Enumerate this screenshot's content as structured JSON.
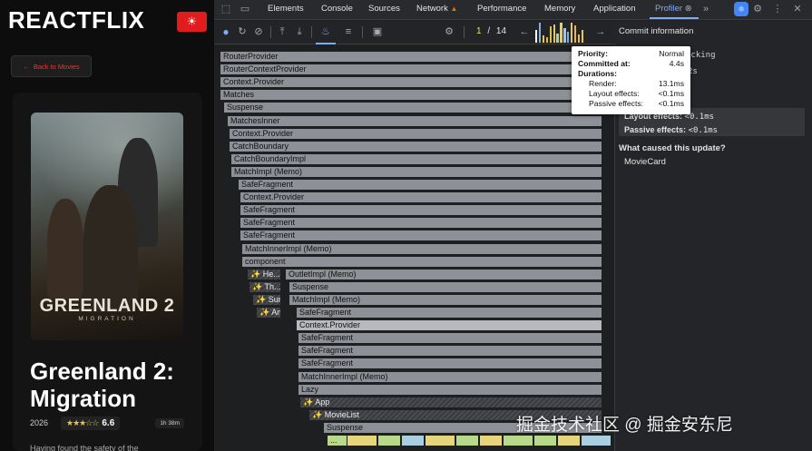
{
  "app": {
    "brand": "REACTFLIX",
    "back_label": "Back to Movies",
    "poster": {
      "title": "GREENLAND 2",
      "subtitle": "MIGRATION"
    },
    "movie": {
      "title": "Greenland 2: Migration",
      "year": "2026",
      "stars": "★★★☆☆",
      "rating": "6.6",
      "duration": "1h 38m",
      "description": "Having found the safety of the"
    }
  },
  "devtools": {
    "tabs": [
      "Elements",
      "Console",
      "Sources",
      "Network",
      "Performance",
      "Memory",
      "Application",
      "Profiler"
    ],
    "active_tab": "Profiler",
    "commit_current": "1",
    "commit_sep": "/",
    "commit_total": "14",
    "flamegraph": [
      "RouterProvider",
      "RouterContextProvider",
      "Context.Provider",
      "Matches",
      "Suspense",
      "MatchesInner",
      "Context.Provider",
      "CatchBoundary",
      "CatchBoundaryImpl",
      "MatchImpl (Memo)",
      "SafeFragment",
      "Context.Provider",
      "SafeFragment",
      "SafeFragment",
      "SafeFragment",
      "MatchInnerImpl (Memo)",
      "component",
      "He...",
      "OutletImpl (Memo)",
      "Th...",
      "Suspense",
      "Sun",
      "MatchImpl (Memo)",
      "Ano...",
      "SafeFragment",
      "Context.Provider",
      "SafeFragment",
      "SafeFragment",
      "SafeFragment",
      "MatchInnerImpl (Memo)",
      "Lazy",
      "App",
      "MovieList",
      "Suspense",
      "..."
    ],
    "sidebar": {
      "title": "Commit information",
      "bg_line1": "ocking",
      "bg_line2": "2s",
      "layout_label": "Layout effects:",
      "layout_value": "<0.1ms",
      "passive_label": "Passive effects:",
      "passive_value": "<0.1ms",
      "why_title": "What caused this update?",
      "why_item": "MovieCard"
    },
    "tooltip": {
      "priority_label": "Priority:",
      "priority_value": "Normal",
      "committed_label": "Committed at:",
      "committed_value": "4.4s",
      "durations_label": "Durations:",
      "render_label": "Render:",
      "render_value": "13.1ms",
      "layout_label": "Layout effects:",
      "layout_value": "<0.1ms",
      "passive_label": "Passive effects:",
      "passive_value": "<0.1ms"
    },
    "commit_bar_colors": [
      "#9ec6e8",
      "#7fb2de",
      "#e6c65a",
      "#f0b24a",
      "#d9c14e",
      "#e6c65a",
      "#b5d18a",
      "#e8d15a"
    ]
  },
  "watermark": "掘金技术社区 @ 掘金安东尼"
}
